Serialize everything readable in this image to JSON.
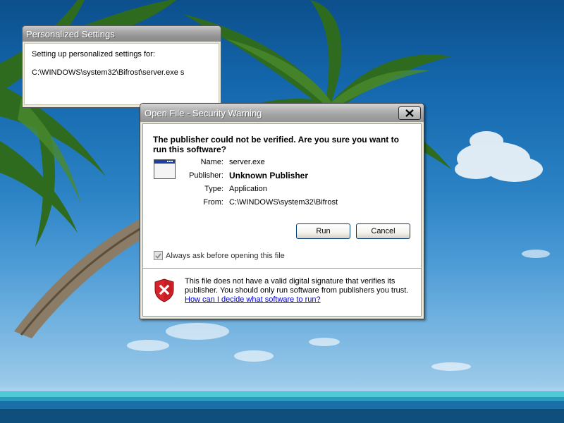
{
  "desktop": {
    "wallpaper": "tropical palm beach"
  },
  "personalized_settings": {
    "title": "Personalized Settings",
    "line1": "Setting up personalized settings for:",
    "path": "C:\\WINDOWS\\system32\\Bifrost\\server.exe s"
  },
  "security_warning": {
    "title": "Open File - Security Warning",
    "question": "The publisher could not be verified.  Are you sure you want to run this software?",
    "details": {
      "name_label": "Name:",
      "name_value": "server.exe",
      "publisher_label": "Publisher:",
      "publisher_value": "Unknown Publisher",
      "type_label": "Type:",
      "type_value": "Application",
      "from_label": "From:",
      "from_value": "C:\\WINDOWS\\system32\\Bifrost"
    },
    "run_label": "Run",
    "cancel_label": "Cancel",
    "checkbox_label": "Always ask before opening this file",
    "checkbox_checked": true,
    "warning_text": "This file does not have a valid digital signature that verifies its publisher.  You should only run software from publishers you trust.",
    "help_link": "How can I decide what software to run?"
  },
  "icons": {
    "close": "close-icon",
    "app": "application-window-icon",
    "shield": "shield-warning-icon",
    "check": "checkmark-icon"
  },
  "colors": {
    "link": "#0000cc",
    "shield_red": "#d8232a",
    "button_border": "#003c74"
  }
}
